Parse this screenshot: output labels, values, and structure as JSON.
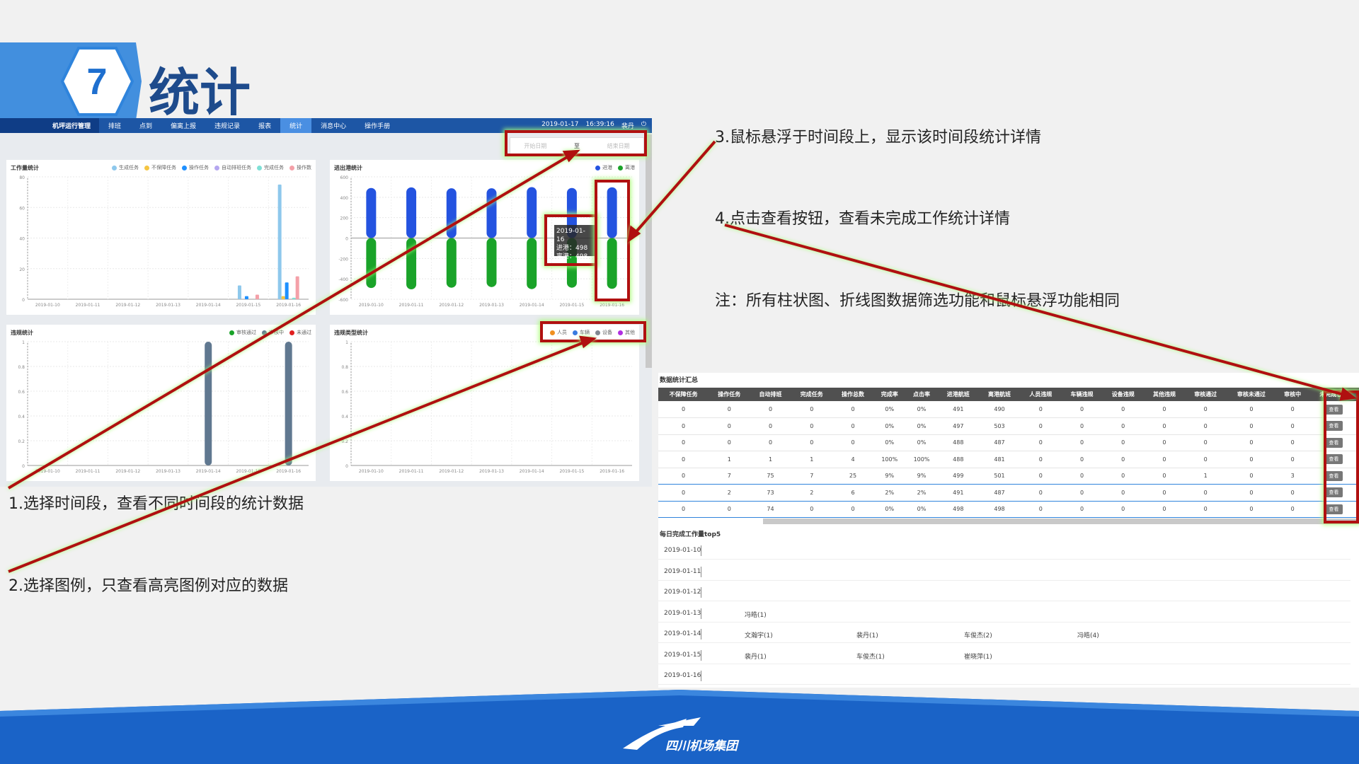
{
  "slide": {
    "number": "7",
    "title": "统计"
  },
  "nav": {
    "brand": "机坪运行管理",
    "items": [
      "排班",
      "点到",
      "偏离上报",
      "违规记录",
      "报表",
      "统计",
      "消息中心",
      "操作手册"
    ],
    "active": "统计",
    "date": "2019-01-17",
    "time": "16:39:16",
    "user": "裴丹"
  },
  "date_range": {
    "start_placeholder": "开始日期",
    "sep": "至",
    "end_placeholder": "结束日期"
  },
  "chart_data": [
    {
      "type": "bar",
      "title": "工作量统计",
      "categories": [
        "2019-01-10",
        "2019-01-11",
        "2019-01-12",
        "2019-01-13",
        "2019-01-14",
        "2019-01-15",
        "2019-01-16"
      ],
      "ylim": [
        0,
        80
      ],
      "yticks": [
        0,
        20,
        40,
        60,
        80
      ],
      "series": [
        {
          "name": "生成任务",
          "color": "#8ec8ec",
          "values": [
            0,
            0,
            0,
            0,
            0,
            9,
            75
          ]
        },
        {
          "name": "不保障任务",
          "color": "#f5c542",
          "values": [
            0,
            0,
            0,
            0,
            0,
            0,
            2
          ]
        },
        {
          "name": "操作任务",
          "color": "#1e90ff",
          "values": [
            0,
            0,
            0,
            0,
            0,
            2,
            11
          ]
        },
        {
          "name": "自动排班任务",
          "color": "#b5a7f0",
          "values": [
            0,
            0,
            0,
            0,
            0,
            0,
            0
          ]
        },
        {
          "name": "完成任务",
          "color": "#7fe0d6",
          "values": [
            0,
            0,
            0,
            0,
            0,
            0,
            1
          ]
        },
        {
          "name": "操作数",
          "color": "#f4a0a8",
          "values": [
            0,
            0,
            0,
            0,
            0,
            3,
            15
          ]
        }
      ]
    },
    {
      "type": "bar",
      "title": "进出港统计",
      "categories": [
        "2019-01-10",
        "2019-01-11",
        "2019-01-12",
        "2019-01-13",
        "2019-01-14",
        "2019-01-15",
        "2019-01-16"
      ],
      "ylim": [
        -600,
        600
      ],
      "yticks": [
        600,
        400,
        200,
        0,
        -200,
        -400,
        -600
      ],
      "series": [
        {
          "name": "进港",
          "color": "#2453e0",
          "values": [
            491,
            497,
            488,
            488,
            499,
            491,
            498
          ]
        },
        {
          "name": "离港",
          "color": "#1aa329",
          "values": [
            -490,
            -503,
            -487,
            -481,
            -501,
            -487,
            -498
          ]
        }
      ]
    },
    {
      "type": "bar",
      "title": "违规统计",
      "categories": [
        "2019-01-10",
        "2019-01-11",
        "2019-01-12",
        "2019-01-13",
        "2019-01-14",
        "2019-01-15",
        "2019-01-16"
      ],
      "ylim": [
        0,
        1
      ],
      "yticks": [
        0,
        0.2,
        0.4,
        0.6,
        0.8,
        1
      ],
      "series": [
        {
          "name": "审核通过",
          "color": "#1aa329",
          "values": [
            0,
            0,
            0,
            0,
            0,
            0,
            0
          ]
        },
        {
          "name": "审核中",
          "color": "#607890",
          "values": [
            0,
            0,
            0,
            0,
            1,
            0,
            1
          ]
        },
        {
          "name": "未通过",
          "color": "#e02020",
          "values": [
            0,
            0,
            0,
            0,
            0,
            0,
            0
          ]
        }
      ]
    },
    {
      "type": "bar",
      "title": "违规类型统计",
      "categories": [
        "2019-01-10",
        "2019-01-11",
        "2019-01-12",
        "2019-01-13",
        "2019-01-14",
        "2019-01-15",
        "2019-01-16"
      ],
      "ylim": [
        0,
        1
      ],
      "yticks": [
        0,
        0.2,
        0.4,
        0.6,
        0.8,
        1
      ],
      "series": [
        {
          "name": "人员",
          "color": "#f09020",
          "values": [
            0,
            0,
            0,
            0,
            0,
            0,
            0
          ]
        },
        {
          "name": "车辆",
          "color": "#3a7be0",
          "values": [
            0,
            0,
            0,
            0,
            0,
            0,
            0
          ]
        },
        {
          "name": "设备",
          "color": "#808890",
          "values": [
            0,
            0,
            0,
            0,
            0,
            0,
            0
          ]
        },
        {
          "name": "其他",
          "color": "#b030e0",
          "values": [
            0,
            0,
            0,
            0,
            0,
            0,
            0
          ]
        }
      ]
    }
  ],
  "tooltip": {
    "date": "2019-01-16",
    "in": "进港：498",
    "out": "离港：498"
  },
  "annotations": [
    "1.选择时间段，查看不同时间段的统计数据",
    "2.选择图例，只查看高亮图例对应的数据",
    "3.鼠标悬浮于时间段上，显示该时间段统计详情",
    "4.点击查看按钮，查看未完成工作统计详情",
    "注：所有柱状图、折线图数据筛选功能和鼠标悬浮功能相同"
  ],
  "table": {
    "title": "数据统计汇总",
    "headers": [
      "不保障任务",
      "操作任务",
      "自动排班",
      "完成任务",
      "操作总数",
      "完成率",
      "点击率",
      "进港航班",
      "离港航班",
      "人员违规",
      "车辆违规",
      "设备违规",
      "其他违规",
      "审核通过",
      "审核未通过",
      "审核中",
      "未完成任务"
    ],
    "button": "查看",
    "rows": [
      [
        "0",
        "0",
        "0",
        "0",
        "0",
        "0%",
        "0%",
        "491",
        "490",
        "0",
        "0",
        "0",
        "0",
        "0",
        "0",
        "0"
      ],
      [
        "0",
        "0",
        "0",
        "0",
        "0",
        "0%",
        "0%",
        "497",
        "503",
        "0",
        "0",
        "0",
        "0",
        "0",
        "0",
        "0"
      ],
      [
        "0",
        "0",
        "0",
        "0",
        "0",
        "0%",
        "0%",
        "488",
        "487",
        "0",
        "0",
        "0",
        "0",
        "0",
        "0",
        "0"
      ],
      [
        "0",
        "1",
        "1",
        "1",
        "4",
        "100%",
        "100%",
        "488",
        "481",
        "0",
        "0",
        "0",
        "0",
        "0",
        "0",
        "0"
      ],
      [
        "0",
        "7",
        "75",
        "7",
        "25",
        "9%",
        "9%",
        "499",
        "501",
        "0",
        "0",
        "0",
        "0",
        "1",
        "0",
        "3"
      ],
      [
        "0",
        "2",
        "73",
        "2",
        "6",
        "2%",
        "2%",
        "491",
        "487",
        "0",
        "0",
        "0",
        "0",
        "0",
        "0",
        "0"
      ],
      [
        "0",
        "0",
        "74",
        "0",
        "0",
        "0%",
        "0%",
        "498",
        "498",
        "0",
        "0",
        "0",
        "0",
        "0",
        "0",
        "0"
      ]
    ]
  },
  "top5": {
    "title": "每日完成工作量top5",
    "rows": [
      {
        "date": "2019-01-10",
        "names": []
      },
      {
        "date": "2019-01-11",
        "names": []
      },
      {
        "date": "2019-01-12",
        "names": []
      },
      {
        "date": "2019-01-13",
        "names": [
          "冯皓(1)"
        ]
      },
      {
        "date": "2019-01-14",
        "names": [
          "文瀚宇(1)",
          "裴丹(1)",
          "车俊杰(2)",
          "冯皓(4)"
        ]
      },
      {
        "date": "2019-01-15",
        "names": [
          "裴丹(1)",
          "车俊杰(1)",
          "崔晓萍(1)"
        ]
      },
      {
        "date": "2019-01-16",
        "names": []
      }
    ]
  },
  "footer": {
    "company": "四川机场集团"
  }
}
